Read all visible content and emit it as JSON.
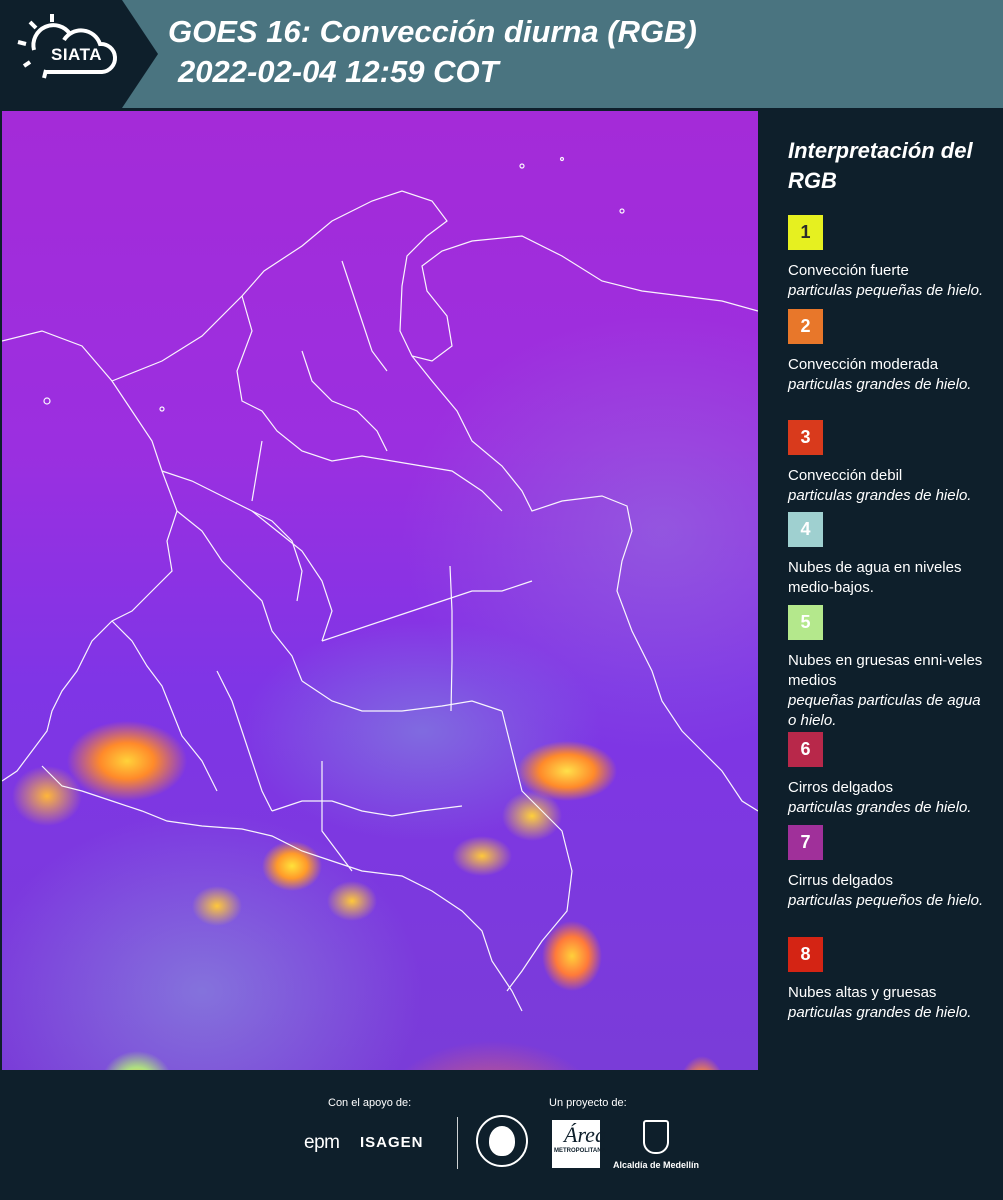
{
  "header": {
    "logo_text": "SIATA",
    "title_line1": "GOES 16: Convección diurna (RGB)",
    "title_line2": "2022-02-04 12:59 COT"
  },
  "legend": {
    "title": "Interpretación del RGB",
    "items": [
      {
        "num": "1",
        "color": "#e6f020",
        "num_color": "#2b2b2b",
        "name": "Convección fuerte",
        "desc": "particulas pequeñas de hielo."
      },
      {
        "num": "2",
        "color": "#e8772a",
        "num_color": "#ffffff",
        "name": "Convección moderada",
        "desc": "particulas grandes de hielo."
      },
      {
        "num": "3",
        "color": "#d93a1c",
        "num_color": "#ffffff",
        "name": "Convección debil",
        "desc": "particulas grandes de hielo."
      },
      {
        "num": "4",
        "color": "#9fd0d0",
        "num_color": "#ffffff",
        "name": "Nubes de agua en niveles medio-bajos.",
        "desc": ""
      },
      {
        "num": "5",
        "color": "#b4e88c",
        "num_color": "#ffffff",
        "name": "Nubes en gruesas enni-veles medios",
        "desc": "pequeñas particulas de agua o hielo."
      },
      {
        "num": "6",
        "color": "#b8284a",
        "num_color": "#ffffff",
        "name": "Cirros delgados",
        "desc": "particulas grandes de hielo."
      },
      {
        "num": "7",
        "color": "#a0309a",
        "num_color": "#ffffff",
        "name": "Cirrus delgados",
        "desc": "particulas pequeños de hielo."
      },
      {
        "num": "8",
        "color": "#d42414",
        "num_color": "#ffffff",
        "name": "Nubes altas y gruesas",
        "desc": "particulas grandes de hielo."
      }
    ]
  },
  "footer": {
    "support_label": "Con el apoyo de:",
    "project_label": "Un proyecto de:",
    "epm": "epm",
    "isagen": "ISAGEN",
    "area_text": "METROPOLITANA",
    "area_glyph": "Área",
    "medellin": "Alcaldía de Medellín"
  }
}
